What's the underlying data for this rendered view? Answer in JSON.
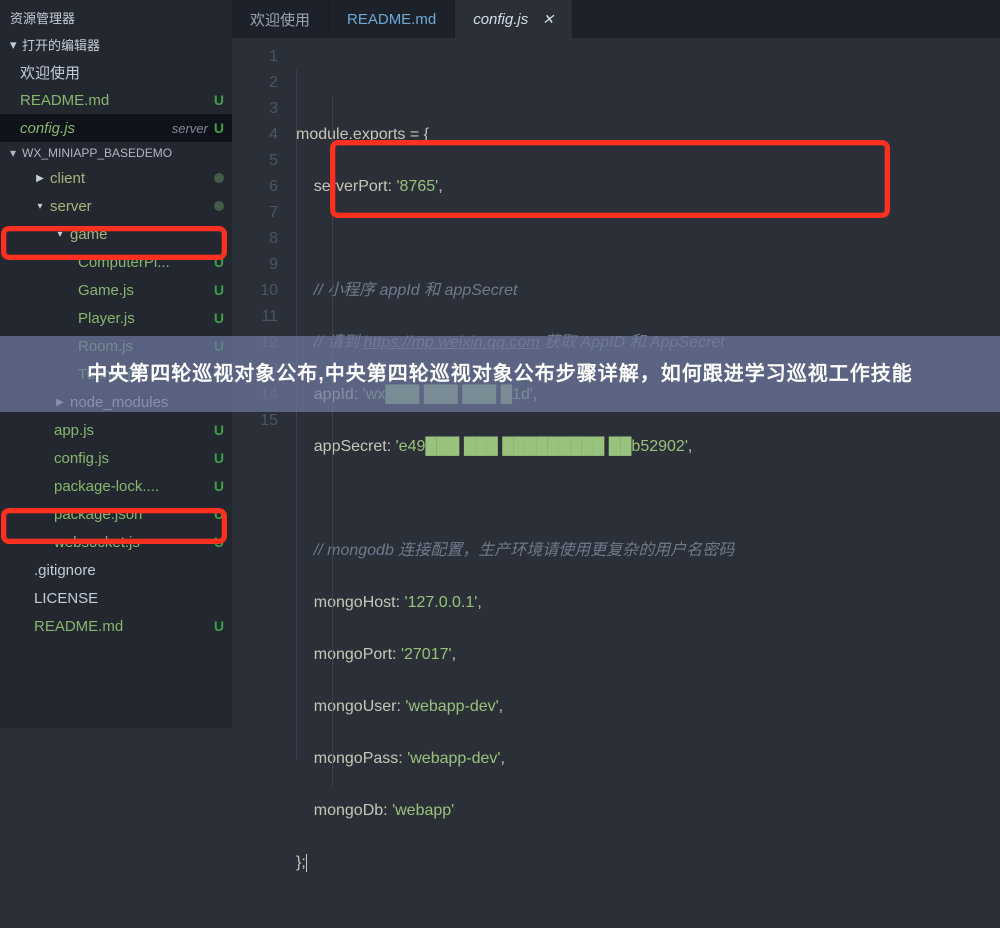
{
  "sidebar": {
    "title": "资源管理器",
    "open_editors_label": "打开的编辑器",
    "editors": [
      {
        "label": "欢迎使用",
        "badge": ""
      },
      {
        "label": "README.md",
        "badge": "U"
      },
      {
        "label": "config.js",
        "sub": "server",
        "badge": "U",
        "active": true
      }
    ],
    "project_label": "WX_MINIAPP_BASEDEMO",
    "tree": [
      {
        "id": "client",
        "label": "client",
        "depth": 1,
        "chev": "▶",
        "olive": true,
        "dot": true
      },
      {
        "id": "server",
        "label": "server",
        "depth": 1,
        "chev": "▾",
        "olive": true,
        "dot": true,
        "box": true
      },
      {
        "id": "game",
        "label": "game",
        "depth": 2,
        "chev": "▾",
        "olive": true
      },
      {
        "id": "ComputerPl",
        "label": "ComputerPl...",
        "depth": 3,
        "green": true,
        "badge": "U"
      },
      {
        "id": "Game",
        "label": "Game.js",
        "depth": 3,
        "green": true,
        "badge": "U"
      },
      {
        "id": "Player",
        "label": "Player.js",
        "depth": 3,
        "green": true,
        "badge": "U"
      },
      {
        "id": "Room",
        "label": "Room.js",
        "depth": 3,
        "green": true,
        "badge": "U"
      },
      {
        "id": "Tunnel",
        "label": "Tunnel.js",
        "depth": 3,
        "green": true,
        "badge": "U"
      },
      {
        "id": "node_modules",
        "label": "node_modules",
        "depth": 2,
        "chev": "▶"
      },
      {
        "id": "appjs",
        "label": "app.js",
        "depth": 2,
        "green": true,
        "badge": "U"
      },
      {
        "id": "configjs",
        "label": "config.js",
        "depth": 2,
        "green": true,
        "badge": "U",
        "box": true
      },
      {
        "id": "pkglock",
        "label": "package-lock....",
        "depth": 2,
        "green": true,
        "badge": "U"
      },
      {
        "id": "pkgjson",
        "label": "package.json",
        "depth": 2,
        "green": true,
        "badge": "U"
      },
      {
        "id": "websocket",
        "label": "websocket.js",
        "depth": 2,
        "green": true,
        "badge": "U"
      },
      {
        "id": "gitignore",
        "label": ".gitignore",
        "depth": 1
      },
      {
        "id": "license",
        "label": "LICENSE",
        "depth": 1
      },
      {
        "id": "readmeroot",
        "label": "README.md",
        "depth": 1,
        "green": true,
        "badge": "U"
      }
    ]
  },
  "tabs": [
    {
      "id": "welcome",
      "label": "欢迎使用"
    },
    {
      "id": "readme",
      "label": "README.md",
      "readme": true
    },
    {
      "id": "config",
      "label": "config.js",
      "active": true,
      "close": true
    }
  ],
  "editor": {
    "file": "config.js",
    "line_count": 15,
    "lines": {
      "l1": "module.exports = {",
      "l2_key": "serverPort",
      "l2_val": "'8765'",
      "l4": "// 小程序 appId 和 appSecret",
      "l5a": "// 请到 ",
      "l5b": "https://mp.weixin.qq.com",
      "l5c": " 获取 AppID 和 AppSecret",
      "l6_key": "appId",
      "l6_val": "'wx███ ███ ███ █1d'",
      "l7_key": "appSecret",
      "l7_val": "'e49███ ███ █████████ ██b52902'",
      "l9": "// mongodb 连接配置，生产环境请使用更复杂的用户名密码",
      "l10_key": "mongoHost",
      "l10_val": "'127.0.0.1'",
      "l11_key": "mongoPort",
      "l11_val": "'27017'",
      "l12_key": "mongoUser",
      "l12_val": "'webapp-dev'",
      "l13_key": "mongoPass",
      "l13_val": "'webapp-dev'",
      "l14_key": "mongoDb",
      "l14_val": "'webapp'",
      "l15": "};"
    }
  },
  "banner": "中央第四轮巡视对象公布,中央第四轮巡视对象公布步骤详解，如何跟进学习巡视工作技能"
}
